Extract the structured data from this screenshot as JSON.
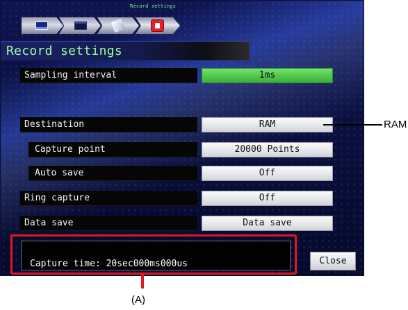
{
  "breadcrumb": {
    "heading": "Record settings",
    "tabs": [
      {
        "icon": "display-settings-icon"
      },
      {
        "icon": "channel-settings-icon"
      },
      {
        "icon": "trigger-settings-icon"
      },
      {
        "icon": "record-settings-icon",
        "active": true
      }
    ]
  },
  "header": {
    "title": "Record settings"
  },
  "settings": [
    {
      "label": "Sampling interval",
      "value": "1ms",
      "selected": true
    },
    {
      "label": "Destination",
      "value": "RAM"
    },
    {
      "label": "Capture point",
      "value": "20000 Points"
    },
    {
      "label": "Auto save",
      "value": "Off"
    },
    {
      "label": "Ring capture",
      "value": "Off"
    },
    {
      "label": "Data save",
      "value": "Data save"
    }
  ],
  "info": {
    "capture_time": "Capture time: 20sec000ms000us"
  },
  "buttons": {
    "close": "Close"
  },
  "annotations": {
    "destination_callout": "RAM",
    "info_callout": "(A)"
  },
  "colors": {
    "screen_background": "#0a0f3e",
    "title_text": "#9cffa1",
    "selected_value": "#4fc74b",
    "callout_red": "#e0191f",
    "active_tab_icon": "#e81f2a"
  }
}
